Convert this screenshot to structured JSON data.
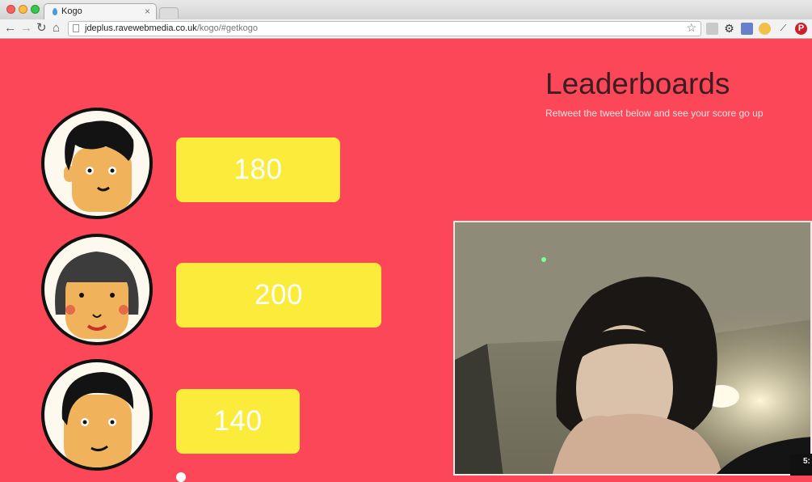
{
  "browser": {
    "tab_title": "Kogo",
    "tab_close": "×",
    "url_host": "jdeplus.ravewebmedia.co.uk",
    "url_path": "/kogo/#getkogo",
    "nav": {
      "back": "←",
      "forward": "→",
      "reload": "↻",
      "home": "⌂"
    },
    "bookmark_star": "☆"
  },
  "leaderboard": {
    "title": "Leaderboards",
    "subtitle": "Retweet the tweet below and see your score go up",
    "players": [
      {
        "avatar": "boy-black-hair-avatar",
        "score": "180"
      },
      {
        "avatar": "girl-bob-hair-avatar",
        "score": "200"
      },
      {
        "avatar": "man-side-part-avatar",
        "score": "140"
      }
    ]
  },
  "video": {
    "timestamp": "5:"
  },
  "colors": {
    "background": "#fb4757",
    "score_box": "#fbeb3b",
    "title_text": "#3b1d22"
  }
}
